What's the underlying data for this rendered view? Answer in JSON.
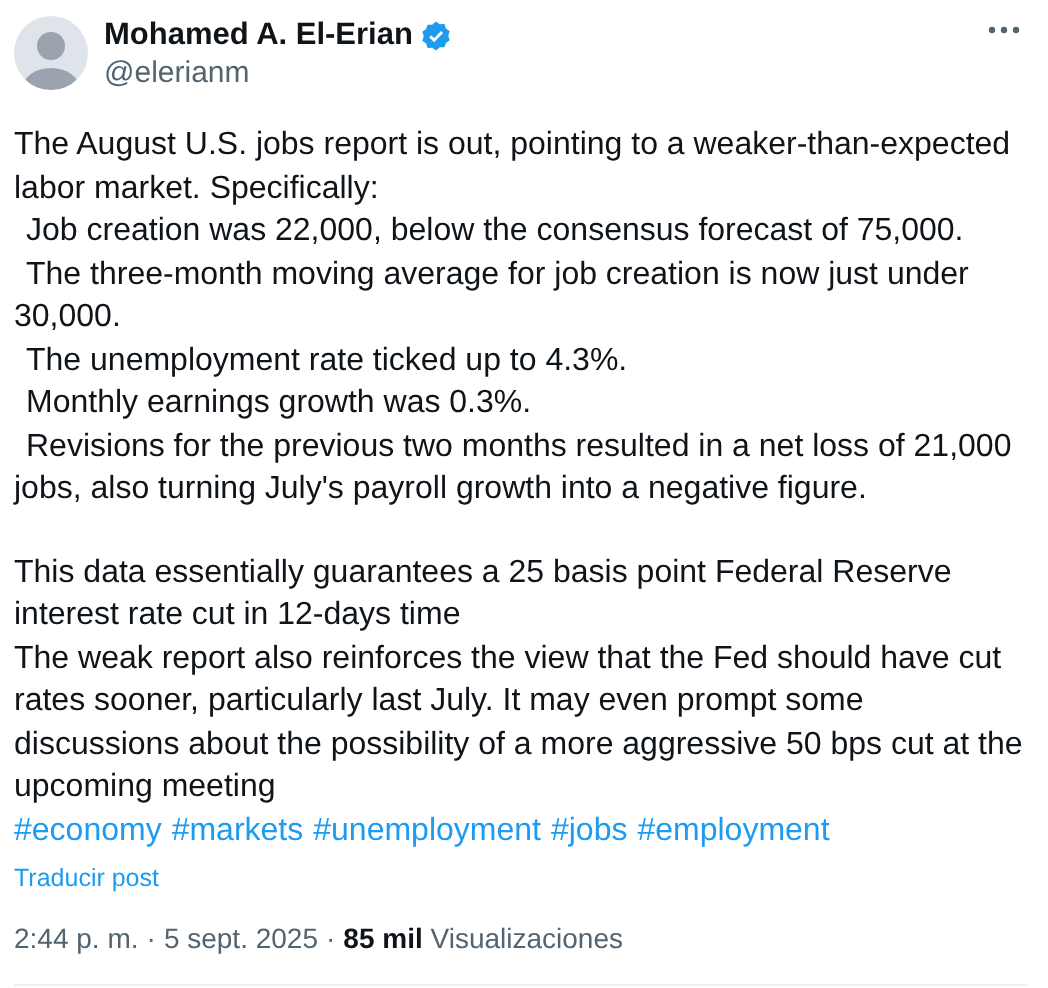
{
  "author": {
    "name": "Mohamed A. El-Erian",
    "verified": true,
    "handle": "@elerianm"
  },
  "blocks": [
    {
      "lines": [
        {
          "kind": "text",
          "text": "The August U.S. jobs report is out, pointing to a weaker-than-expected labor market. Specifically:"
        },
        {
          "kind": "item",
          "text": "Job creation was 22,000, below the consensus forecast of 75,000."
        },
        {
          "kind": "item",
          "text": "The three-month moving average for job creation is now just under 30,000."
        },
        {
          "kind": "item",
          "text": "The unemployment rate ticked up to 4.3%."
        },
        {
          "kind": "item",
          "text": "Monthly earnings growth was 0.3%."
        },
        {
          "kind": "item",
          "text": "Revisions for the previous two months resulted in a net loss of 21,000 jobs, also turning July's payroll growth into a negative figure."
        }
      ]
    },
    {
      "lines": [
        {
          "kind": "text",
          "text": "This data essentially guarantees a 25 basis point Federal Reserve interest rate cut in 12-days time"
        },
        {
          "kind": "text",
          "text": "The weak report also reinforces the view that the Fed should have cut rates sooner, particularly last July. It may even prompt some discussions about the possibility of a more aggressive 50 bps cut at the upcoming meeting"
        }
      ]
    }
  ],
  "hashtags": [
    "#economy",
    "#markets",
    "#unemployment",
    "#jobs",
    "#employment"
  ],
  "translate_link": "Traducir post",
  "meta": {
    "time": "2:44 p. m.",
    "separator": "·",
    "date": "5 sept. 2025",
    "views_count": "85 mil",
    "views_label": "Visualizaciones"
  }
}
